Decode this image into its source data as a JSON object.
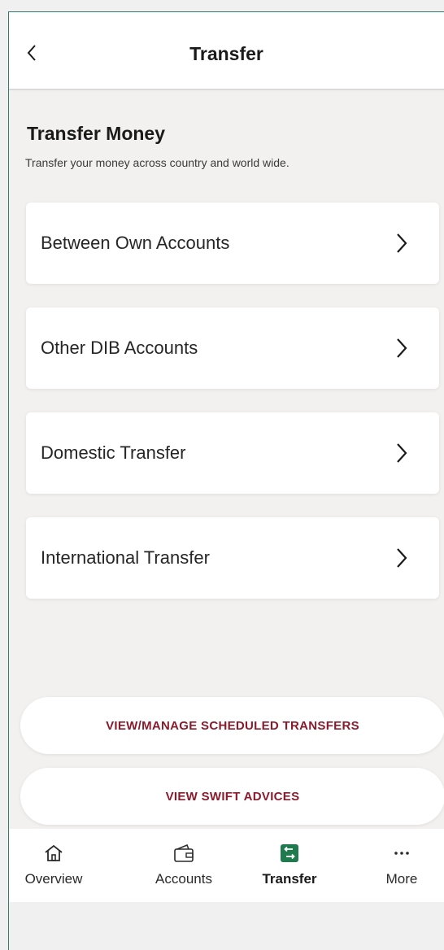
{
  "header": {
    "title": "Transfer",
    "back_icon": "chevron-left-icon"
  },
  "section": {
    "title": "Transfer Money",
    "subtitle": "Transfer your money across country and world wide."
  },
  "options": [
    {
      "label": "Between Own Accounts",
      "icon": "chevron-right-icon"
    },
    {
      "label": "Other DIB Accounts",
      "icon": "chevron-right-icon"
    },
    {
      "label": "Domestic Transfer",
      "icon": "chevron-right-icon"
    },
    {
      "label": "International Transfer",
      "icon": "chevron-right-icon"
    }
  ],
  "actions": {
    "scheduled_label": "VIEW/MANAGE SCHEDULED TRANSFERS",
    "swift_label": "VIEW SWIFT ADVICES"
  },
  "tabbar": {
    "items": [
      {
        "label": "Overview",
        "icon": "home-icon"
      },
      {
        "label": "Accounts",
        "icon": "wallet-icon"
      },
      {
        "label": "Transfer",
        "icon": "transfer-icon",
        "active": true
      },
      {
        "label": "More",
        "icon": "more-icon"
      }
    ]
  },
  "colors": {
    "accent_text": "#8a1b2c",
    "active_tab_icon": "#1f7a4e",
    "frame_border": "#2f7d68"
  }
}
